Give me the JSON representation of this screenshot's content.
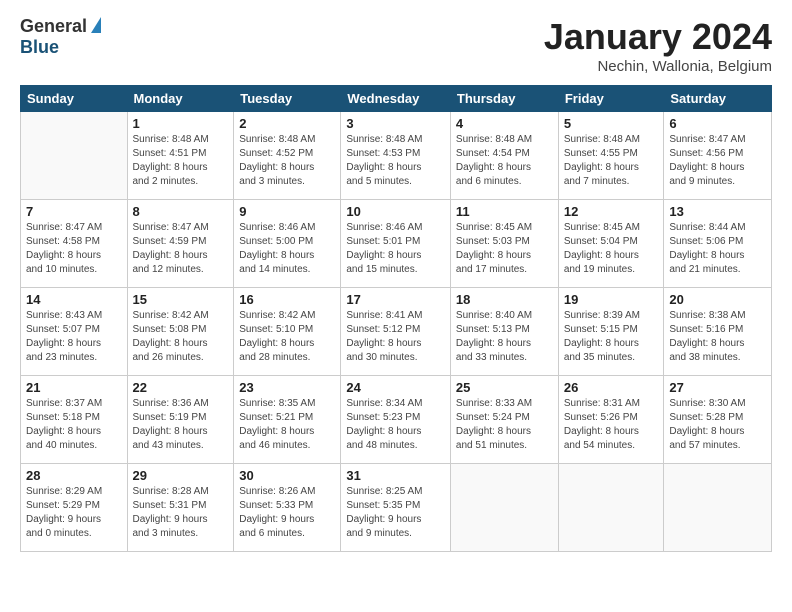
{
  "header": {
    "logo_general": "General",
    "logo_blue": "Blue",
    "month_title": "January 2024",
    "location": "Nechin, Wallonia, Belgium"
  },
  "weekdays": [
    "Sunday",
    "Monday",
    "Tuesday",
    "Wednesday",
    "Thursday",
    "Friday",
    "Saturday"
  ],
  "weeks": [
    [
      {
        "day": "",
        "info": ""
      },
      {
        "day": "1",
        "info": "Sunrise: 8:48 AM\nSunset: 4:51 PM\nDaylight: 8 hours\nand 2 minutes."
      },
      {
        "day": "2",
        "info": "Sunrise: 8:48 AM\nSunset: 4:52 PM\nDaylight: 8 hours\nand 3 minutes."
      },
      {
        "day": "3",
        "info": "Sunrise: 8:48 AM\nSunset: 4:53 PM\nDaylight: 8 hours\nand 5 minutes."
      },
      {
        "day": "4",
        "info": "Sunrise: 8:48 AM\nSunset: 4:54 PM\nDaylight: 8 hours\nand 6 minutes."
      },
      {
        "day": "5",
        "info": "Sunrise: 8:48 AM\nSunset: 4:55 PM\nDaylight: 8 hours\nand 7 minutes."
      },
      {
        "day": "6",
        "info": "Sunrise: 8:47 AM\nSunset: 4:56 PM\nDaylight: 8 hours\nand 9 minutes."
      }
    ],
    [
      {
        "day": "7",
        "info": "Sunrise: 8:47 AM\nSunset: 4:58 PM\nDaylight: 8 hours\nand 10 minutes."
      },
      {
        "day": "8",
        "info": "Sunrise: 8:47 AM\nSunset: 4:59 PM\nDaylight: 8 hours\nand 12 minutes."
      },
      {
        "day": "9",
        "info": "Sunrise: 8:46 AM\nSunset: 5:00 PM\nDaylight: 8 hours\nand 14 minutes."
      },
      {
        "day": "10",
        "info": "Sunrise: 8:46 AM\nSunset: 5:01 PM\nDaylight: 8 hours\nand 15 minutes."
      },
      {
        "day": "11",
        "info": "Sunrise: 8:45 AM\nSunset: 5:03 PM\nDaylight: 8 hours\nand 17 minutes."
      },
      {
        "day": "12",
        "info": "Sunrise: 8:45 AM\nSunset: 5:04 PM\nDaylight: 8 hours\nand 19 minutes."
      },
      {
        "day": "13",
        "info": "Sunrise: 8:44 AM\nSunset: 5:06 PM\nDaylight: 8 hours\nand 21 minutes."
      }
    ],
    [
      {
        "day": "14",
        "info": "Sunrise: 8:43 AM\nSunset: 5:07 PM\nDaylight: 8 hours\nand 23 minutes."
      },
      {
        "day": "15",
        "info": "Sunrise: 8:42 AM\nSunset: 5:08 PM\nDaylight: 8 hours\nand 26 minutes."
      },
      {
        "day": "16",
        "info": "Sunrise: 8:42 AM\nSunset: 5:10 PM\nDaylight: 8 hours\nand 28 minutes."
      },
      {
        "day": "17",
        "info": "Sunrise: 8:41 AM\nSunset: 5:12 PM\nDaylight: 8 hours\nand 30 minutes."
      },
      {
        "day": "18",
        "info": "Sunrise: 8:40 AM\nSunset: 5:13 PM\nDaylight: 8 hours\nand 33 minutes."
      },
      {
        "day": "19",
        "info": "Sunrise: 8:39 AM\nSunset: 5:15 PM\nDaylight: 8 hours\nand 35 minutes."
      },
      {
        "day": "20",
        "info": "Sunrise: 8:38 AM\nSunset: 5:16 PM\nDaylight: 8 hours\nand 38 minutes."
      }
    ],
    [
      {
        "day": "21",
        "info": "Sunrise: 8:37 AM\nSunset: 5:18 PM\nDaylight: 8 hours\nand 40 minutes."
      },
      {
        "day": "22",
        "info": "Sunrise: 8:36 AM\nSunset: 5:19 PM\nDaylight: 8 hours\nand 43 minutes."
      },
      {
        "day": "23",
        "info": "Sunrise: 8:35 AM\nSunset: 5:21 PM\nDaylight: 8 hours\nand 46 minutes."
      },
      {
        "day": "24",
        "info": "Sunrise: 8:34 AM\nSunset: 5:23 PM\nDaylight: 8 hours\nand 48 minutes."
      },
      {
        "day": "25",
        "info": "Sunrise: 8:33 AM\nSunset: 5:24 PM\nDaylight: 8 hours\nand 51 minutes."
      },
      {
        "day": "26",
        "info": "Sunrise: 8:31 AM\nSunset: 5:26 PM\nDaylight: 8 hours\nand 54 minutes."
      },
      {
        "day": "27",
        "info": "Sunrise: 8:30 AM\nSunset: 5:28 PM\nDaylight: 8 hours\nand 57 minutes."
      }
    ],
    [
      {
        "day": "28",
        "info": "Sunrise: 8:29 AM\nSunset: 5:29 PM\nDaylight: 9 hours\nand 0 minutes."
      },
      {
        "day": "29",
        "info": "Sunrise: 8:28 AM\nSunset: 5:31 PM\nDaylight: 9 hours\nand 3 minutes."
      },
      {
        "day": "30",
        "info": "Sunrise: 8:26 AM\nSunset: 5:33 PM\nDaylight: 9 hours\nand 6 minutes."
      },
      {
        "day": "31",
        "info": "Sunrise: 8:25 AM\nSunset: 5:35 PM\nDaylight: 9 hours\nand 9 minutes."
      },
      {
        "day": "",
        "info": ""
      },
      {
        "day": "",
        "info": ""
      },
      {
        "day": "",
        "info": ""
      }
    ]
  ]
}
